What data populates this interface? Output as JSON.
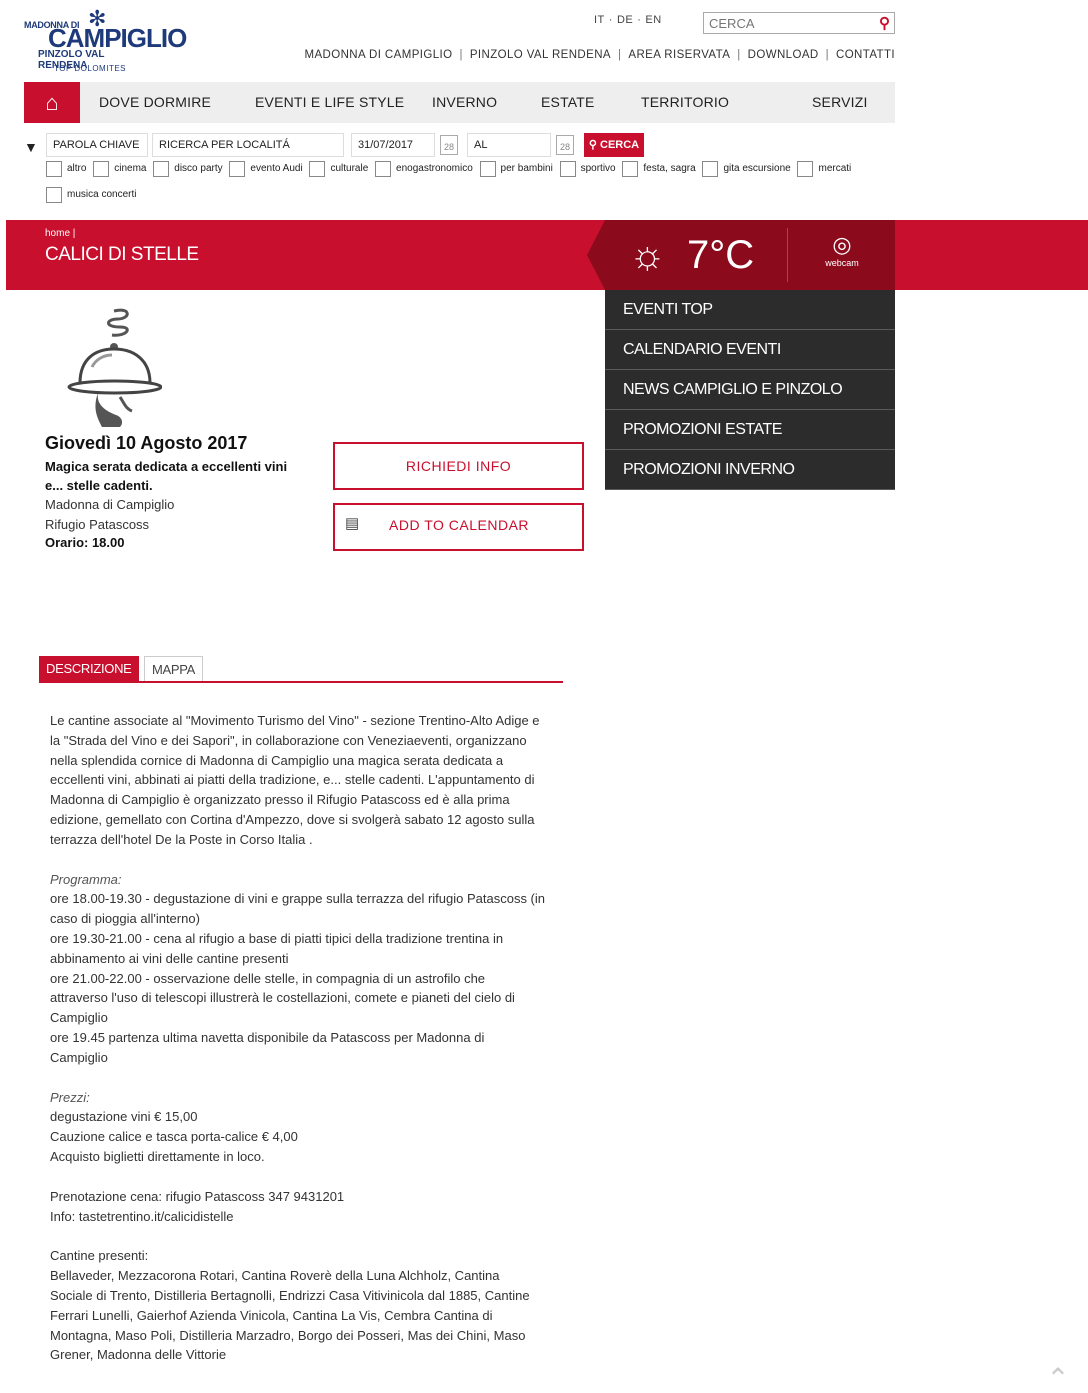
{
  "logo": {
    "line1": "MADONNA DI",
    "line2": "CAMPIGLIO",
    "line3": "PINZOLO VAL RENDENA",
    "line4": "TOP DOLOMITES"
  },
  "languages": [
    "IT",
    "DE",
    "EN"
  ],
  "top_search": {
    "placeholder": "CERCA"
  },
  "top_links": [
    "MADONNA DI CAMPIGLIO",
    "PINZOLO VAL RENDENA",
    "AREA RISERVATA",
    "DOWNLOAD",
    "CONTATTI"
  ],
  "nav": {
    "items": [
      "DOVE DORMIRE",
      "EVENTI E LIFE STYLE",
      "INVERNO",
      "ESTATE",
      "TERRITORIO",
      "SERVIZI"
    ]
  },
  "filter": {
    "keyword": "PAROLA CHIAVE",
    "location": "RICERCA PER LOCALITÁ",
    "date_from": "31/07/2017",
    "date_to": "AL",
    "cal_day": "28",
    "search_label": "CERCA",
    "categories": [
      "altro",
      "cinema",
      "disco party",
      "evento Audi",
      "culturale",
      "enogastronomico",
      "per bambini",
      "sportivo",
      "festa, sagra",
      "gita escursione",
      "mercati",
      "musica concerti"
    ]
  },
  "band": {
    "breadcrumb": "home |",
    "title": "CALICI DI STELLE",
    "temperature": "7°C",
    "webcam_label": "webcam"
  },
  "sidemenu": [
    "EVENTI TOP",
    "CALENDARIO EVENTI",
    "NEWS CAMPIGLIO E PINZOLO",
    "PROMOZIONI ESTATE",
    "PROMOZIONI INVERNO"
  ],
  "event": {
    "date": "Giovedì 10 Agosto 2017",
    "summary": "Magica serata dedicata a eccellenti vini e... stelle cadenti.",
    "town": "Madonna di Campiglio",
    "venue": "Rifugio Patascoss",
    "time": "Orario: 18.00",
    "info_button": "RICHIEDI INFO",
    "calendar_button": "ADD TO CALENDAR"
  },
  "tabs": [
    "DESCRIZIONE",
    "MAPPA"
  ],
  "description": {
    "intro": "Le cantine associate al \"Movimento Turismo del Vino\" - sezione Trentino-Alto Adige e la \"Strada del Vino e dei Sapori\", in collaborazione con Veneziaeventi, organizzano nella splendida cornice di Madonna di Campiglio  una magica serata dedicata a eccellenti vini, abbinati ai piatti della tradizione, e... stelle cadenti. L'appuntamento di Madonna di Campiglio è organizzato presso il Rifugio Patascoss ed è alla prima edizione, gemellato con  Cortina d'Ampezzo, dove si svolgerà sabato 12 agosto sulla terrazza dell'hotel De la Poste in Corso Italia .",
    "program_title": "Programma:",
    "program": [
      "ore 18.00-19.30 - degustazione di vini e grappe sulla terrazza del rifugio Patascoss (in caso di pioggia all'interno)",
      "ore 19.30-21.00 - cena al rifugio a base di piatti tipici della tradizione trentina in abbinamento ai vini delle cantine presenti",
      "ore 21.00-22.00 - osservazione delle stelle, in compagnia di un astrofilo che attraverso l'uso di telescopi illustrerà le costellazioni, comete e pianeti del cielo di Campiglio",
      "ore 19.45 partenza ultima navetta disponibile da Patascoss per Madonna di Campiglio"
    ],
    "prices_title": "Prezzi:",
    "prices": [
      "degustazione vini € 15,00",
      "Cauzione calice  e tasca porta-calice € 4,00",
      "Acquisto biglietti direttamente in loco."
    ],
    "booking": "Prenotazione cena: rifugio Patascoss 347 9431201",
    "info": "Info: tastetrentino.it/calicidistelle",
    "wineries_title": "Cantine presenti:",
    "wineries": "Bellaveder, Mezzacorona Rotari, Cantina Roverè della Luna Alchholz, Cantina Sociale di Trento, Distilleria Bertagnolli, Endrizzi Casa Vitivinicola dal 1885, Cantine Ferrari Lunelli, Gaierhof Azienda Vinicola, Cantina La Vis, Cembra Cantina di Montagna, Maso Poli, Distilleria Marzadro, Borgo dei Posseri, Mas dei Chini, Maso Grener, Madonna delle Vittorie"
  }
}
